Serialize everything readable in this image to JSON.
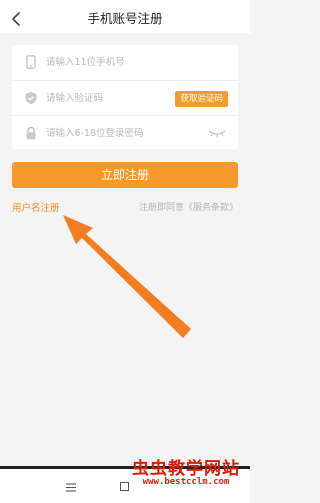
{
  "header": {
    "title": "手机账号注册",
    "back_icon": "chevron-left-icon"
  },
  "form": {
    "phone": {
      "placeholder": "请输入11位手机号",
      "value": "",
      "icon": "phone-icon"
    },
    "code": {
      "placeholder": "请输入验证码",
      "value": "",
      "icon": "shield-icon",
      "button_label": "获取验证码"
    },
    "password": {
      "placeholder": "请输入6-18位登录密码",
      "value": "",
      "icon": "lock-icon",
      "toggle_icon": "eye-closed-icon"
    }
  },
  "register_button": {
    "label": "立即注册"
  },
  "links": {
    "username_register": "用户名注册",
    "agreement": "注册即同意《服务条款》"
  },
  "bottom_nav": {
    "icons": [
      "menu-icon",
      "home-icon"
    ]
  },
  "watermark": {
    "title": "虫虫教学网站",
    "url": "www.bestcclm.com"
  },
  "colors": {
    "accent": "#f79a2a",
    "link": "#f08a1c",
    "watermark": "#d81e06",
    "background": "#f4f4f4"
  }
}
